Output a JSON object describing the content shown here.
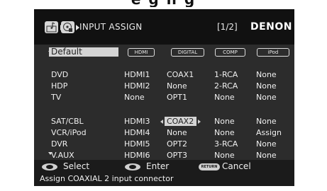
{
  "top_fragment": "e  g    n      g",
  "header": {
    "title": "INPUT ASSIGN",
    "page": "[1/2]",
    "brand": "DENON"
  },
  "default_label": "Default",
  "columns": [
    "HDMI",
    "DIGITAL",
    "COMP",
    "iPod"
  ],
  "rows": [
    {
      "source": "DVD",
      "hdmi": "HDMI1",
      "digital": "COAX1",
      "comp": "1-RCA",
      "ipod": "None"
    },
    {
      "source": "HDP",
      "hdmi": "HDMI2",
      "digital": "None",
      "comp": "2-RCA",
      "ipod": "None"
    },
    {
      "source": "TV",
      "hdmi": "None",
      "digital": "OPT1",
      "comp": "None",
      "ipod": "None"
    },
    {
      "source": "SAT/CBL",
      "hdmi": "HDMI3",
      "digital": "COAX2",
      "comp": "None",
      "ipod": "None"
    },
    {
      "source": "VCR/iPod",
      "hdmi": "HDMI4",
      "digital": "None",
      "comp": "None",
      "ipod": "Assign"
    },
    {
      "source": "DVR",
      "hdmi": "HDMI5",
      "digital": "OPT2",
      "comp": "3-RCA",
      "ipod": "None"
    },
    {
      "source": "V.AUX",
      "hdmi": "HDMI6",
      "digital": "OPT3",
      "comp": "None",
      "ipod": "None"
    }
  ],
  "selected": {
    "row": 3,
    "column": "digital",
    "value": "COAX2"
  },
  "footer": {
    "select": "Select",
    "enter": "Enter",
    "return_key": "RETURN",
    "cancel": "Cancel"
  },
  "help_text": "Assign COAXIAL 2 input connector",
  "icons": [
    "music-input-icon",
    "disc-input-icon"
  ]
}
